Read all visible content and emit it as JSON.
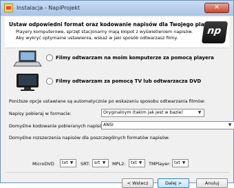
{
  "window": {
    "title": "Instalacja - NapiProjekt",
    "close_label": "✕"
  },
  "header": {
    "title": "Ustaw odpowiedni format oraz kodowanie napisów dla Twojego playera.",
    "desc": "Playery komputerowe, sprzęt stacjonarny mają kłopot z wyświetleniem napisów. Aby wykryć optymalne ustawienia, wskaż w jaki sposób odtwarzasz filmy.",
    "logo_text": "np"
  },
  "options": {
    "computer": "Filmy odtwarzam na moim komputerze za pomocą playera",
    "tv": "Filmy odtwarzam za pomocą TV lub odtwarzacza DVD"
  },
  "info_text": "Poniższe opcje ustawiane są automatycznie po wskazaniu sposobu odtwarzania filmów:",
  "settings": {
    "format_label": "Napisy pobieraj w formacie:",
    "format_value": "Oryginalnym (takim jak jest w bazie)",
    "encoding_label": "Domyślne kodowanie pobieranych napisów:",
    "encoding_value": "ANSI",
    "extensions_label": "Domyślne rozszerzenia napisów dla poszczególnych formatów napisów:"
  },
  "formats": [
    {
      "label": "MicroDVD",
      "value": "txt"
    },
    {
      "label": "SRT:",
      "value": "srt"
    },
    {
      "label": "MPL2:",
      "value": "txt"
    },
    {
      "label": "TMPlayer:",
      "value": "txt"
    }
  ],
  "buttons": {
    "back": "< Wstecz",
    "next": "Dalej >",
    "cancel": "Anuluj"
  }
}
